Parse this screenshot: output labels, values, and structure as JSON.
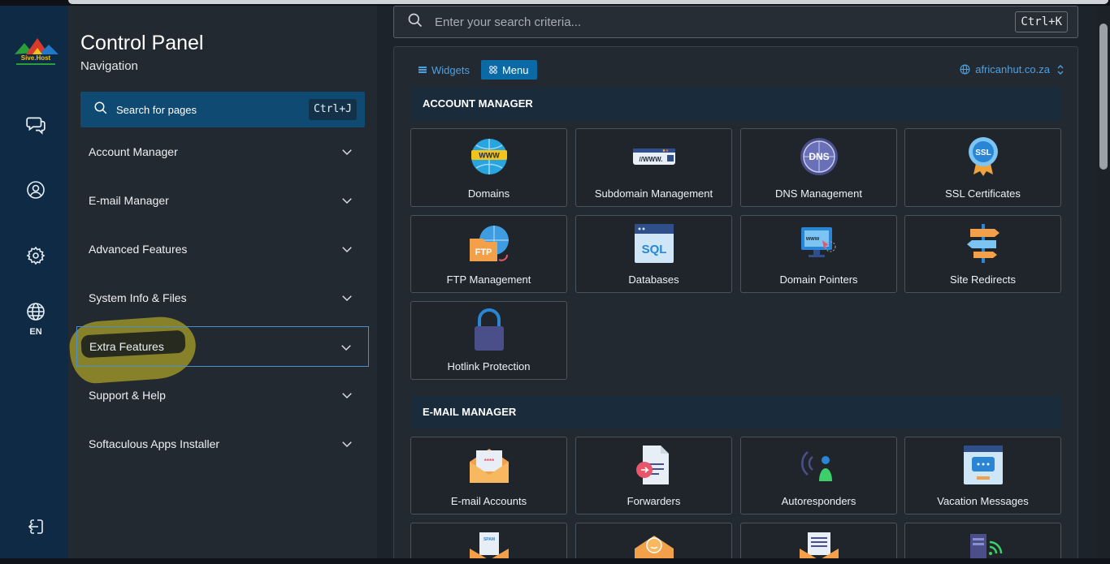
{
  "app": {
    "title": "Control Panel",
    "subtitle": "Navigation",
    "brand_logo_text": "Sive.Host"
  },
  "rail": {
    "items": [
      "chat",
      "account",
      "settings",
      "language",
      "logout"
    ],
    "lang_label": "EN"
  },
  "nav": {
    "search_placeholder": "Search for pages",
    "search_shortcut": "Ctrl+J",
    "items": [
      {
        "label": "Account Manager"
      },
      {
        "label": "E-mail Manager"
      },
      {
        "label": "Advanced Features"
      },
      {
        "label": "System Info & Files"
      },
      {
        "label": "Extra Features"
      },
      {
        "label": "Support & Help"
      },
      {
        "label": "Softaculous Apps Installer"
      }
    ]
  },
  "main": {
    "search_placeholder": "Enter your search criteria...",
    "search_shortcut": "Ctrl+K",
    "tabs": {
      "widgets": "Widgets",
      "menu": "Menu"
    },
    "domain": "africanhut.co.za",
    "sections": [
      {
        "title": "ACCOUNT MANAGER",
        "tiles": [
          "Domains",
          "Subdomain Management",
          "DNS Management",
          "SSL Certificates",
          "FTP Management",
          "Databases",
          "Domain Pointers",
          "Site Redirects",
          "Hotlink Protection"
        ]
      },
      {
        "title": "E-MAIL MANAGER",
        "tiles": [
          "E-mail Accounts",
          "Forwarders",
          "Autoresponders",
          "Vacation Messages"
        ]
      }
    ]
  },
  "colors": {
    "rail": "#0f2a44",
    "accent": "#0b6aa6",
    "link": "#4ea0e0",
    "highlight": "#aaa028"
  }
}
